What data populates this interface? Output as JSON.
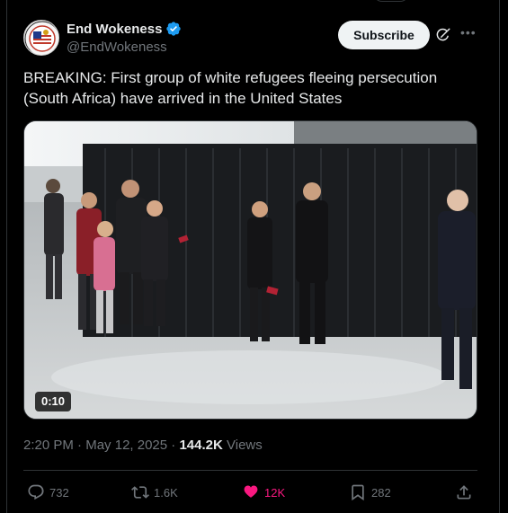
{
  "author": {
    "display_name": "End Wokeness",
    "handle": "@EndWokeness",
    "verified": true
  },
  "header": {
    "subscribe_label": "Subscribe"
  },
  "tweet": {
    "text": "BREAKING: First group of white refugees fleeing persecution (South Africa) have arrived in the United States"
  },
  "media": {
    "type": "video",
    "duration": "0:10"
  },
  "meta": {
    "time": "2:20 PM",
    "separator": "·",
    "date": "May 12, 2025",
    "views_count": "144.2K",
    "views_label": "Views"
  },
  "actions": {
    "replies": "732",
    "reposts": "1.6K",
    "likes": "12K",
    "bookmarks": "282"
  },
  "colors": {
    "background": "#000000",
    "text_primary": "#e7e9ea",
    "text_secondary": "#71767b",
    "like_active": "#f91880",
    "verified_blue": "#1d9bf0",
    "border": "#2f3336"
  },
  "icons": {
    "verified": "verified-badge-icon",
    "grok": "grok-icon",
    "more": "more-icon",
    "reply": "reply-icon",
    "repost": "repost-icon",
    "like": "heart-icon",
    "bookmark": "bookmark-icon",
    "share": "share-icon"
  }
}
